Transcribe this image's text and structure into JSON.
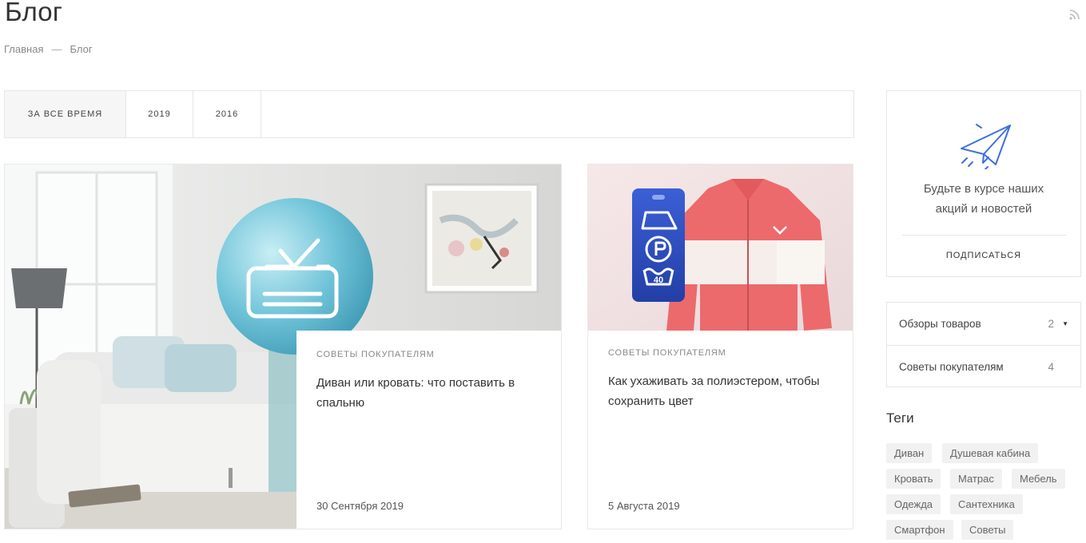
{
  "page": {
    "title": "Блог"
  },
  "breadcrumb": {
    "home": "Главная",
    "separator": "—",
    "current": "Блог"
  },
  "filters": [
    {
      "label": "ЗА ВСЕ ВРЕМЯ",
      "active": true
    },
    {
      "label": "2019",
      "active": false
    },
    {
      "label": "2016",
      "active": false
    }
  ],
  "posts": [
    {
      "category": "СОВЕТЫ ПОКУПАТЕЛЯМ",
      "title": "Диван или кровать: что поставить в спальню",
      "date": "30 Сентября 2019",
      "image": "bedroom-sofa-bed-photo"
    },
    {
      "category": "СОВЕТЫ ПОКУПАТЕЛЯМ",
      "title": "Как ухаживать за полиэстером, чтобы сохранить цвет",
      "date": "5 Августа 2019",
      "image": "polyester-jacket-care-label-photo",
      "care_label_text": "40"
    }
  ],
  "subscribe": {
    "line1": "Будьте в курсе наших",
    "line2": "акций и новостей",
    "button": "ПОДПИСАТЬСЯ",
    "icon": "paper-plane-icon",
    "accent": "#3d6fe0"
  },
  "categories": [
    {
      "label": "Обзоры товаров",
      "count": "2",
      "has_arrow": true
    },
    {
      "label": "Советы покупателям",
      "count": "4",
      "has_arrow": false
    }
  ],
  "tags_title": "Теги",
  "tags": [
    "Диван",
    "Душевая кабина",
    "Кровать",
    "Матрас",
    "Мебель",
    "Одежда",
    "Сантехника",
    "Смартфон",
    "Советы"
  ]
}
